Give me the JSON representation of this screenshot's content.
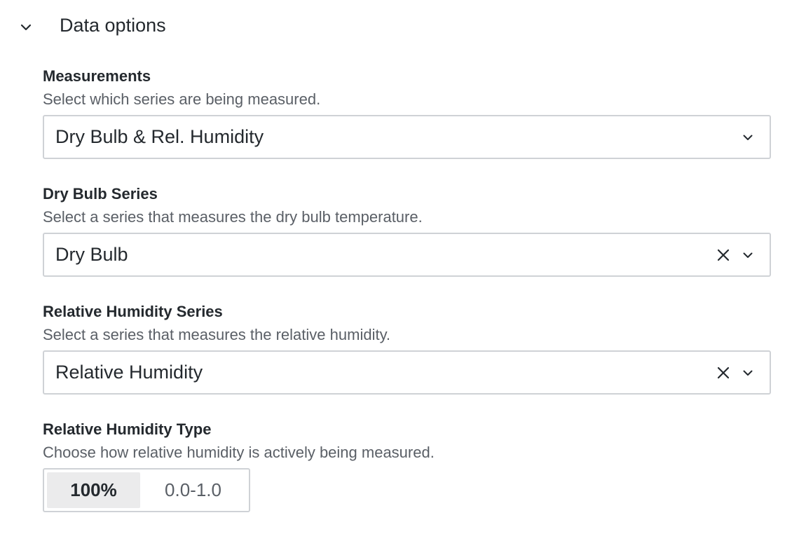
{
  "section": {
    "title": "Data options",
    "toggle_icon": "chevron-down-icon"
  },
  "measurements": {
    "label": "Measurements",
    "description": "Select which series are being measured.",
    "value": "Dry Bulb & Rel. Humidity"
  },
  "dry_bulb": {
    "label": "Dry Bulb Series",
    "description": "Select a series that measures the dry bulb temperature.",
    "value": "Dry Bulb"
  },
  "relative_humidity": {
    "label": "Relative Humidity Series",
    "description": "Select a series that measures the relative humidity.",
    "value": "Relative Humidity"
  },
  "humidity_type": {
    "label": "Relative Humidity Type",
    "description": "Choose how relative humidity is actively being measured.",
    "options": [
      {
        "label": "100%",
        "selected": true
      },
      {
        "label": "0.0-1.0",
        "selected": false
      }
    ]
  },
  "colors": {
    "text": "#24292e",
    "muted_text": "#5a5f66",
    "border": "#cfd2d6",
    "selected_bg": "#ebebec"
  }
}
